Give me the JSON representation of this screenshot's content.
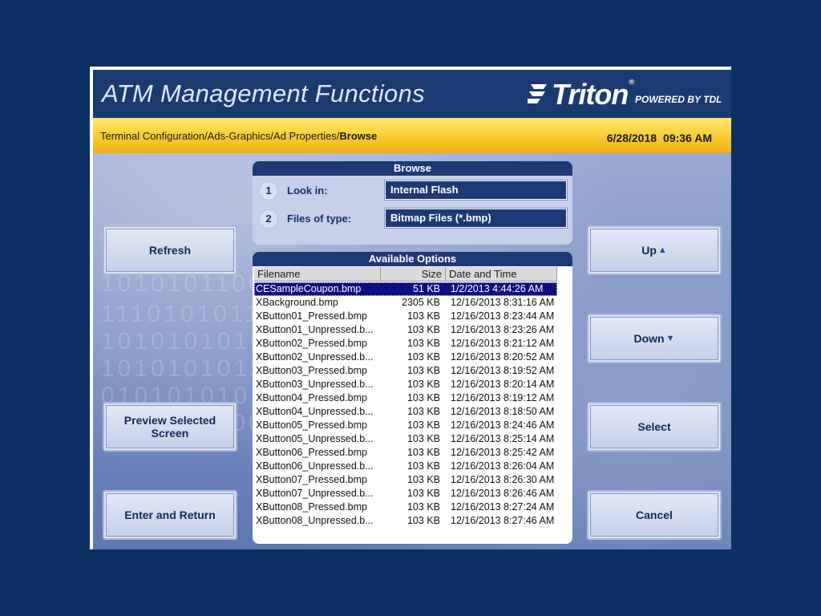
{
  "header": {
    "title": "ATM Management Functions",
    "logo_word": "Triton",
    "logo_reg": "®",
    "logo_powered": "POWERED BY TDL"
  },
  "breadcrumb": {
    "path": "Terminal Configuration/Ads-Graphics/Ad Properties/",
    "current": "Browse"
  },
  "status": {
    "date": "6/28/2018",
    "time": "09:36 AM"
  },
  "watermark_lines": [
    "1010101100",
    "1110101011",
    "1010101010",
    "1010101011",
    "0101010101",
    "1010101100"
  ],
  "buttons": {
    "refresh": "Refresh",
    "preview": "Preview Selected Screen",
    "enter_return": "Enter and Return",
    "up": "Up",
    "down": "Down",
    "select": "Select",
    "cancel": "Cancel",
    "up_arrow": "▲",
    "down_arrow": "▼"
  },
  "browse": {
    "title": "Browse",
    "look_in_num": "1",
    "look_in_label": "Look in:",
    "look_in_value": "Internal Flash",
    "files_type_num": "2",
    "files_type_label": "Files of type:",
    "files_type_value": "Bitmap Files (*.bmp)"
  },
  "options": {
    "title": "Available Options",
    "columns": [
      "Filename",
      "Size",
      "Date and Time"
    ],
    "selected_index": 0,
    "files": [
      {
        "name": "CESampleCoupon.bmp",
        "size": "51 KB",
        "date": "1/2/2013 4:44:26 AM"
      },
      {
        "name": "XBackground.bmp",
        "size": "2305 KB",
        "date": "12/16/2013 8:31:16 AM"
      },
      {
        "name": "XButton01_Pressed.bmp",
        "size": "103 KB",
        "date": "12/16/2013 8:23:44 AM"
      },
      {
        "name": "XButton01_Unpressed.b...",
        "size": "103 KB",
        "date": "12/16/2013 8:23:26 AM"
      },
      {
        "name": "XButton02_Pressed.bmp",
        "size": "103 KB",
        "date": "12/16/2013 8:21:12 AM"
      },
      {
        "name": "XButton02_Unpressed.b...",
        "size": "103 KB",
        "date": "12/16/2013 8:20:52 AM"
      },
      {
        "name": "XButton03_Pressed.bmp",
        "size": "103 KB",
        "date": "12/16/2013 8:19:52 AM"
      },
      {
        "name": "XButton03_Unpressed.b...",
        "size": "103 KB",
        "date": "12/16/2013 8:20:14 AM"
      },
      {
        "name": "XButton04_Pressed.bmp",
        "size": "103 KB",
        "date": "12/16/2013 8:19:12 AM"
      },
      {
        "name": "XButton04_Unpressed.b...",
        "size": "103 KB",
        "date": "12/16/2013 8:18:50 AM"
      },
      {
        "name": "XButton05_Pressed.bmp",
        "size": "103 KB",
        "date": "12/16/2013 8:24:46 AM"
      },
      {
        "name": "XButton05_Unpressed.b...",
        "size": "103 KB",
        "date": "12/16/2013 8:25:14 AM"
      },
      {
        "name": "XButton06_Pressed.bmp",
        "size": "103 KB",
        "date": "12/16/2013 8:25:42 AM"
      },
      {
        "name": "XButton06_Unpressed.b...",
        "size": "103 KB",
        "date": "12/16/2013 8:26:04 AM"
      },
      {
        "name": "XButton07_Pressed.bmp",
        "size": "103 KB",
        "date": "12/16/2013 8:26:30 AM"
      },
      {
        "name": "XButton07_Unpressed.b...",
        "size": "103 KB",
        "date": "12/16/2013 8:26:46 AM"
      },
      {
        "name": "XButton08_Pressed.bmp",
        "size": "103 KB",
        "date": "12/16/2013 8:27:24 AM"
      },
      {
        "name": "XButton08_Unpressed.b...",
        "size": "103 KB",
        "date": "12/16/2013 8:27:46 AM"
      }
    ]
  },
  "colors": {
    "page_background": "#0d3064",
    "header_background": "#1c3a72",
    "crumbbar_yellow": "#f9c92a",
    "panel_navy": "#1d3a76",
    "selection": "#0e0f80"
  },
  "icons": {
    "logo": "triton-logo-icon",
    "up": "triangle-up-icon",
    "down": "triangle-down-icon"
  }
}
